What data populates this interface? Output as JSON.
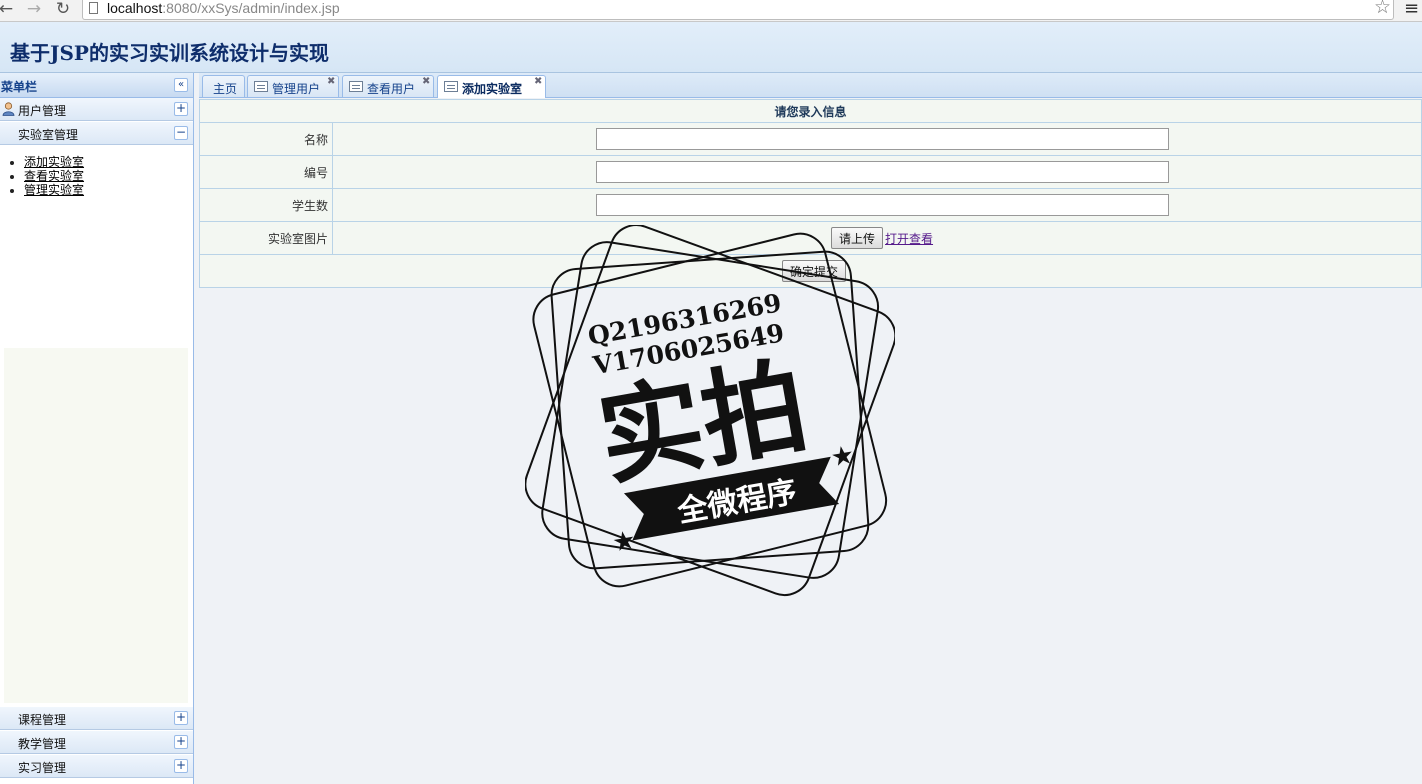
{
  "browser": {
    "url_host": "localhost",
    "url_rest": ":8080/xxSys/admin/index.jsp",
    "back_icon": "back-arrow-icon",
    "forward_icon": "forward-arrow-icon",
    "reload_icon": "reload-icon"
  },
  "header": {
    "title": "基于JSP的实习实训系统设计与实现"
  },
  "sidebar": {
    "title": "菜单栏",
    "sections": [
      {
        "label": "用户管理",
        "toggle": "+"
      },
      {
        "label": "实验室管理",
        "toggle": "−"
      },
      {
        "label": "课程管理",
        "toggle": "+"
      },
      {
        "label": "教学管理",
        "toggle": "+"
      },
      {
        "label": "实习管理",
        "toggle": "+"
      }
    ],
    "sub_items": [
      "添加实验室",
      "查看实验室",
      "管理实验室"
    ]
  },
  "tabs": [
    {
      "label": "主页"
    },
    {
      "label": "管理用户"
    },
    {
      "label": "查看用户"
    },
    {
      "label": "添加实验室",
      "active": true
    }
  ],
  "form": {
    "caption": "请您录入信息",
    "fields": [
      {
        "label": "名称",
        "value": ""
      },
      {
        "label": "编号",
        "value": ""
      },
      {
        "label": "学生数",
        "value": ""
      }
    ],
    "image_label": "实验室图片",
    "upload_button": "请上传",
    "open_link": "打开查看",
    "submit_button": "确定提交"
  },
  "watermark": {
    "line1": "Q2196316269",
    "line2": "V1706025649",
    "big": "实拍",
    "ribbon": "全微程序"
  }
}
